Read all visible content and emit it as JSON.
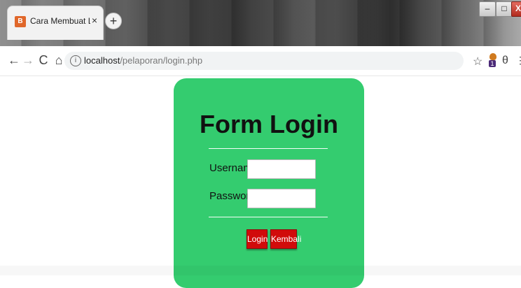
{
  "browser": {
    "tab_title": "Cara Membuat Logout Otomatis",
    "tab_close": "×",
    "new_tab": "+",
    "window_controls": {
      "minimize": "–",
      "maximize": "□",
      "close": "X"
    }
  },
  "address_bar": {
    "host": "localhost",
    "path": "/pelaporan/login.php"
  },
  "toolbar_icons": {
    "back": "←",
    "forward": "→",
    "reload": "C",
    "home": "⌂",
    "info": "i",
    "star": "☆",
    "extension_badge": "1",
    "profile": "θ",
    "menu": "⋮"
  },
  "login_form": {
    "title": "Form Login",
    "username_label": "Username",
    "password_label": "Password",
    "username_value": "",
    "password_value": "",
    "login_button": "Login",
    "back_button": "Kembali"
  },
  "colors": {
    "card_bg": "#34cc6f",
    "button_bg": "#d10b0b"
  }
}
